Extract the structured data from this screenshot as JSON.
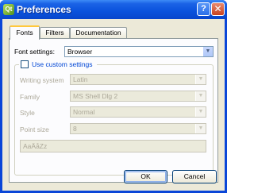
{
  "window": {
    "title": "Preferences",
    "app_icon": "qt-logo-icon",
    "app_icon_glyph": "Qt",
    "help_glyph": "?",
    "close_glyph": "✕"
  },
  "tabs": [
    {
      "label": "Fonts",
      "active": true
    },
    {
      "label": "Filters",
      "active": false
    },
    {
      "label": "Documentation",
      "active": false
    }
  ],
  "fonts": {
    "font_settings_label": "Font settings:",
    "font_settings_value": "Browser",
    "use_custom_label": "Use custom settings",
    "use_custom_checked": false,
    "writing_system_label": "Writing system",
    "writing_system_value": "Latin",
    "family_label": "Family",
    "family_value": "MS Shell Dlg 2",
    "style_label": "Style",
    "style_value": "Normal",
    "point_size_label": "Point size",
    "point_size_value": "8",
    "preview_text": "AaÄåZz"
  },
  "buttons": {
    "ok": "OK",
    "cancel": "Cancel"
  },
  "icons": {
    "dropdown_arrow": "chevron-down-icon",
    "dropdown_glyph": "▼"
  },
  "colors": {
    "titlebar": "#0a52dc",
    "client_bg": "#ece9d8",
    "tab_highlight": "#ffc83c",
    "group_title": "#0046d5",
    "disabled_text": "#aca899"
  }
}
